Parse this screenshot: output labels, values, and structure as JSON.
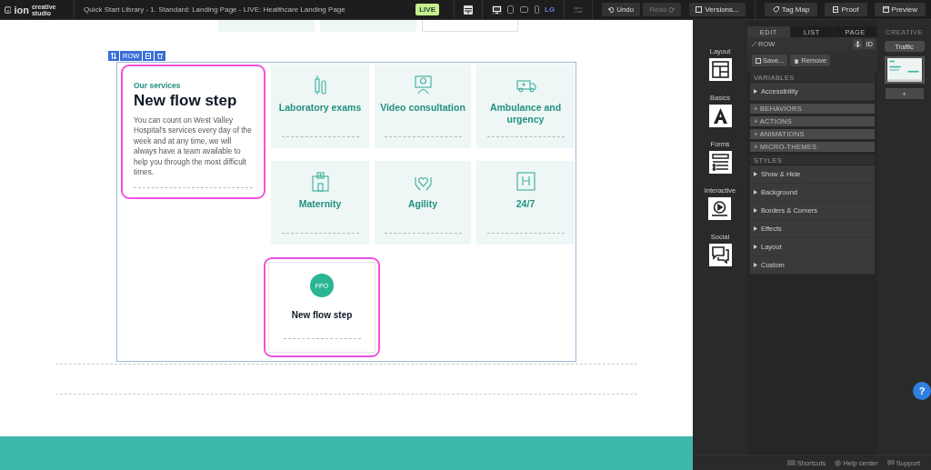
{
  "top_bar": {
    "logo": "ion",
    "brand": "creative studio",
    "breadcrumb": "Quick Start Library - 1. Standard: Landing Page - LIVE: Healthcare Landing Page",
    "status": "LIVE",
    "devices": [
      {
        "kind": "desktop",
        "selected": true
      },
      {
        "kind": "tablet",
        "selected": false
      },
      {
        "kind": "landscape",
        "selected": false
      },
      {
        "kind": "phone",
        "selected": false
      }
    ],
    "size_label": "LG",
    "undo": {
      "label": "Undo",
      "disabled": false
    },
    "redo": {
      "label": "Redo",
      "disabled": true
    },
    "versions": "Versions...",
    "actions": [
      {
        "kind": "tag",
        "label": "Tag Map"
      },
      {
        "kind": "proof",
        "label": "Proof"
      },
      {
        "kind": "preview",
        "label": "Preview"
      }
    ]
  },
  "canvas": {
    "row_badge": "ROW",
    "intro": {
      "eyebrow": "Our services",
      "heading": "New flow step",
      "body": "You can count on West Valley Hospital's services every day of the week and at any time, we will always have a team available to help you through the most difficult times."
    },
    "services": [
      {
        "kind": "tubes",
        "label": "Laboratory exams"
      },
      {
        "kind": "doctor",
        "label": "Video consultation"
      },
      {
        "kind": "ambulance",
        "label": "Ambulance and urgency"
      },
      {
        "kind": "hospital",
        "label": "Maternity"
      },
      {
        "kind": "hands",
        "label": "Agility"
      },
      {
        "kind": "sign",
        "label": "24/7"
      }
    ],
    "new_step": {
      "badge": "FPO",
      "title": "New flow step"
    }
  },
  "panel": {
    "palette": [
      {
        "kind": "layout",
        "label": "Layout"
      },
      {
        "kind": "basics",
        "label": "Basics"
      },
      {
        "kind": "forms",
        "label": "Forms"
      },
      {
        "kind": "interactive",
        "label": "Interactive"
      },
      {
        "kind": "social",
        "label": "Social"
      }
    ],
    "tabs": [
      {
        "label": "EDIT",
        "selected": true
      },
      {
        "label": "LIST",
        "selected": false
      },
      {
        "label": "PAGE",
        "selected": false
      }
    ],
    "element": "ROW",
    "id_button": "ID",
    "save": "Save...",
    "remove": "Remove",
    "sections": [
      {
        "kind": "header",
        "label": "VARIABLES"
      },
      {
        "kind": "item",
        "label": "Accessibility"
      },
      {
        "kind": "add",
        "label": "+ BEHAVIORS"
      },
      {
        "kind": "add",
        "label": "+ ACTIONS"
      },
      {
        "kind": "add",
        "label": "+ ANIMATIONS"
      },
      {
        "kind": "add",
        "label": "+ MICRO-THEMES"
      },
      {
        "kind": "header",
        "label": "STYLES"
      },
      {
        "kind": "item",
        "label": "Show & Hide"
      },
      {
        "kind": "item",
        "label": "Background"
      },
      {
        "kind": "item",
        "label": "Borders & Corners"
      },
      {
        "kind": "item",
        "label": "Effects"
      },
      {
        "kind": "item",
        "label": "Layout"
      },
      {
        "kind": "item",
        "label": "Custom"
      }
    ],
    "creative": {
      "title": "CREATIVE",
      "traffic": "Traffic",
      "add": "+"
    },
    "footer": [
      {
        "kind": "keyboard",
        "label": "Shortcuts"
      },
      {
        "kind": "help",
        "label": "Help center"
      },
      {
        "kind": "chat",
        "label": "Support"
      }
    ],
    "help_button": "?"
  }
}
